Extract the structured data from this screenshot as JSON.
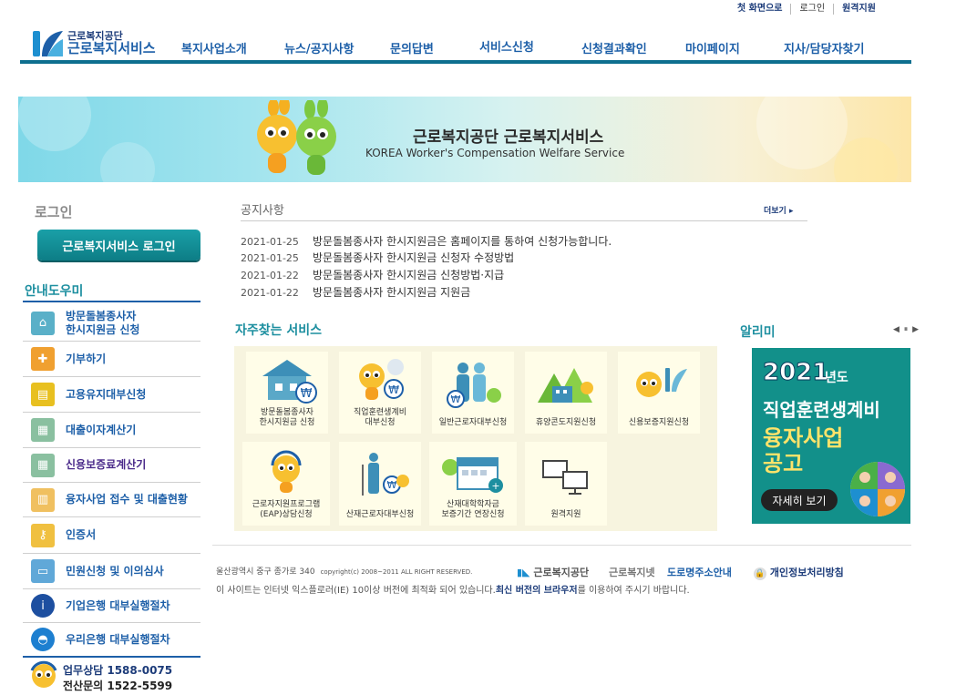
{
  "utility": [
    "첫 화면으로",
    "로그인",
    "원격지원"
  ],
  "logo": {
    "sub": "근로복지공단",
    "main": "근로복지서비스"
  },
  "nav": [
    "복지사업소개",
    "뉴스/공지사항",
    "문의답변",
    "서비스신청",
    "신청결과확인",
    "마이페이지",
    "지사/담당자찾기"
  ],
  "banner": {
    "title": "근로복지공단 근로복지서비스",
    "subtitle": "KOREA Worker's Compensation Welfare Service"
  },
  "login": {
    "title": "로그인",
    "button": "근로복지서비스 로그인"
  },
  "guide": {
    "title": "안내도우미",
    "items": [
      {
        "label1": "방문돌봄종사자",
        "label2": "한시지원금 신청",
        "icon": "house-icon",
        "color": "#5ab0c8"
      },
      {
        "label1": "기부하기",
        "label2": "",
        "icon": "gift-icon",
        "color": "#f0a030"
      },
      {
        "label1": "고용유지대부신청",
        "label2": "",
        "icon": "card-icon",
        "color": "#e8c020"
      },
      {
        "label1": "대출이자계산기",
        "label2": "",
        "icon": "calculator-icon",
        "color": "#8ac0a0"
      },
      {
        "label1": "신용보증료계산기",
        "label2": "",
        "icon": "calculator-icon",
        "color": "#8ac0a0"
      },
      {
        "label1": "융자사업 접수 및 대출현황",
        "label2": "",
        "icon": "chart-icon",
        "color": "#f0c060"
      },
      {
        "label1": "인증서",
        "label2": "",
        "icon": "key-icon",
        "color": "#f0c040"
      },
      {
        "label1": "민원신청 및 이의심사",
        "label2": "",
        "icon": "document-icon",
        "color": "#60a8d8"
      },
      {
        "label1": "기업은행 대부실행절차",
        "label2": "",
        "icon": "ibk-logo-icon",
        "color": "#1d4fa0"
      },
      {
        "label1": "우리은행 대부실행절차",
        "label2": "",
        "icon": "woori-logo-icon",
        "color": "#1d7fd0"
      }
    ]
  },
  "phone": {
    "l1": "업무상담  1588-0075",
    "l2": "전산문의  1522-5599"
  },
  "notice": {
    "title": "공지사항",
    "more": "더보기 ▸",
    "rows": [
      {
        "date": "2021-01-25",
        "text": "방문돌봄종사자 한시지원금은 홈페이지를 통하여 신청가능합니다."
      },
      {
        "date": "2021-01-25",
        "text": "방문돌봄종사자 한시지원금 신청자 수정방법"
      },
      {
        "date": "2021-01-22",
        "text": "방문돌봄종사자 한시지원금 신청방법·지급"
      },
      {
        "date": "2021-01-22",
        "text": "방문돌봄종사자 한시지원금 지원금"
      }
    ]
  },
  "services": {
    "title": "자주찾는 서비스",
    "items": [
      {
        "l1": "방문돌봄종사자",
        "l2": "한시지원금 신청",
        "icon": "house-money-icon"
      },
      {
        "l1": "직업훈련생계비",
        "l2": "대부신청",
        "icon": "mascot-money-icon"
      },
      {
        "l1": "일반근로자대부신청",
        "l2": "",
        "icon": "family-money-icon"
      },
      {
        "l1": "휴양콘도지원신청",
        "l2": "",
        "icon": "condo-icon"
      },
      {
        "l1": "신용보증지원신청",
        "l2": "",
        "icon": "mascot-logo-icon"
      },
      {
        "l1": "근로자지원프로그램",
        "l2": "(EAP)상담신청",
        "icon": "mascot-headset-icon"
      },
      {
        "l1": "산재근로자대부신청",
        "l2": "",
        "icon": "injured-worker-icon"
      },
      {
        "l1": "산재대학학자금",
        "l2": "보증기간 연장신청",
        "icon": "calendar-icon"
      },
      {
        "l1": "원격지원",
        "l2": "",
        "icon": "monitor-icon"
      }
    ]
  },
  "alimi": {
    "title": "알리미",
    "controls": "◀ ⏸ ▶",
    "year": "2021",
    "year_suffix": "년도",
    "line1": "직업훈련생계비",
    "line2": "융자사업",
    "line3": "공고",
    "button": "자세히 보기"
  },
  "footer": {
    "address": "울산광역시 중구 종가로 340",
    "copyright": "copyright(c) 2008~2011 ALL RIGHT RESERVED.",
    "logo1": "근로복지공단",
    "logo2": "근로복지넷",
    "link1": "도로명주소안내",
    "link2": "개인정보처리방침",
    "notice_pre": "이 사이트는 인터넷 익스플로러(IE) 10이상 버전에 최적화 되어 있습니다.",
    "notice_bold": "최신 버전의 브라우저",
    "notice_post": "를 이용하여 주시기 바랍니다."
  },
  "colors": {
    "brand": "#1d5fa8",
    "teal": "#0e6f8f",
    "accent": "#1d8fa0"
  }
}
